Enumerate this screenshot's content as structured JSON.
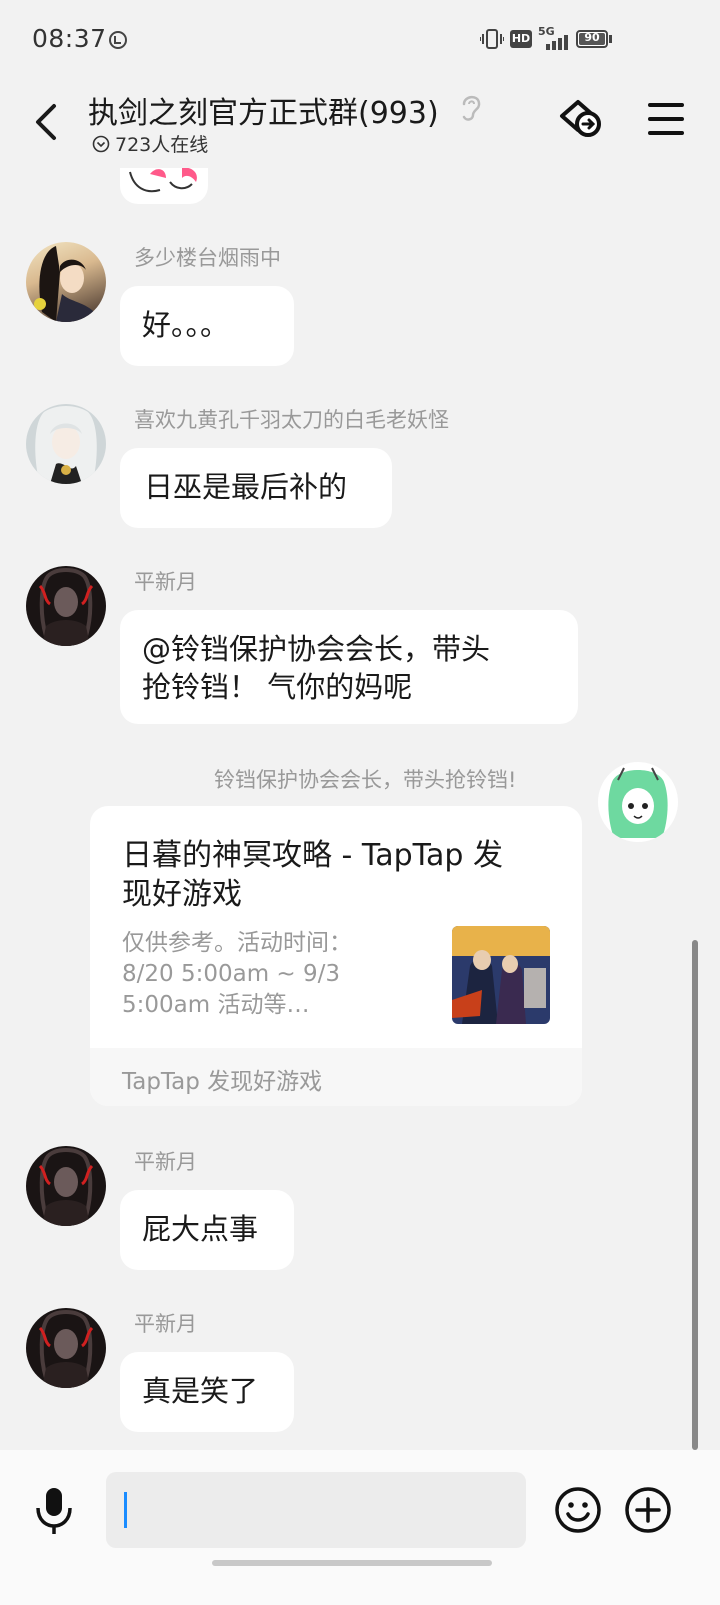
{
  "status_bar": {
    "time": "08:37",
    "hd_label": "HD",
    "network_label": "5G",
    "battery": "90"
  },
  "header": {
    "title": "执剑之刻官方正式群(993)",
    "online_count": "723人在线"
  },
  "messages": [
    {
      "sender": "多少楼台烟雨中",
      "text": "好。。。"
    },
    {
      "sender": "喜欢九黄孔千羽太刀的白毛老妖怪",
      "text": "日巫是最后补的"
    },
    {
      "sender": "平新月",
      "text_line1": "@铃铛保护协会会长，带头",
      "text_line2": "抢铃铛！ 气你的妈呢"
    },
    {
      "sender": "铃铛保护协会会长，带头抢铃铛!",
      "card": {
        "title_line1": "日暮的神冥攻略 - TapTap 发",
        "title_line2": "现好游戏",
        "desc_line1": "仅供参考。活动时间：",
        "desc_line2": "8/20 5:00am ~ 9/3",
        "desc_line3": "5:00am 活动等…",
        "source": "TapTap 发现好游戏"
      }
    },
    {
      "sender": "平新月",
      "text": "屁大点事"
    },
    {
      "sender": "平新月",
      "text": "真是笑了"
    }
  ],
  "input": {
    "value": "",
    "placeholder": ""
  },
  "icons": {
    "back": "back-arrow-icon",
    "ear": "ear-icon",
    "unfriend": "group-exit-icon",
    "menu": "menu-icon",
    "mic": "microphone-icon",
    "emoji": "emoji-icon",
    "plus": "plus-icon"
  },
  "colors": {
    "background": "#f2f2f2",
    "bubble": "#ffffff",
    "sender_gray": "#999999",
    "cursor_blue": "#1a8cff"
  }
}
